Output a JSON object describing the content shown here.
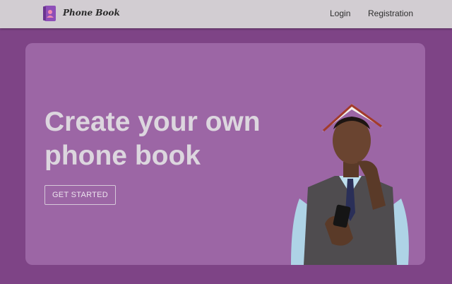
{
  "header": {
    "brand": "Phone Book",
    "logo_icon": "phone-book-icon",
    "nav": {
      "login": "Login",
      "registration": "Registration"
    }
  },
  "hero": {
    "title": "Create your own phone book",
    "cta_label": "GET STARTED",
    "image": "man-with-book-on-head-looking-at-phone"
  },
  "colors": {
    "page_background": "#7e4486",
    "navbar_background": "#d2cdd2",
    "hero_background": "#9c66a5",
    "hero_text": "#dcd6de"
  }
}
